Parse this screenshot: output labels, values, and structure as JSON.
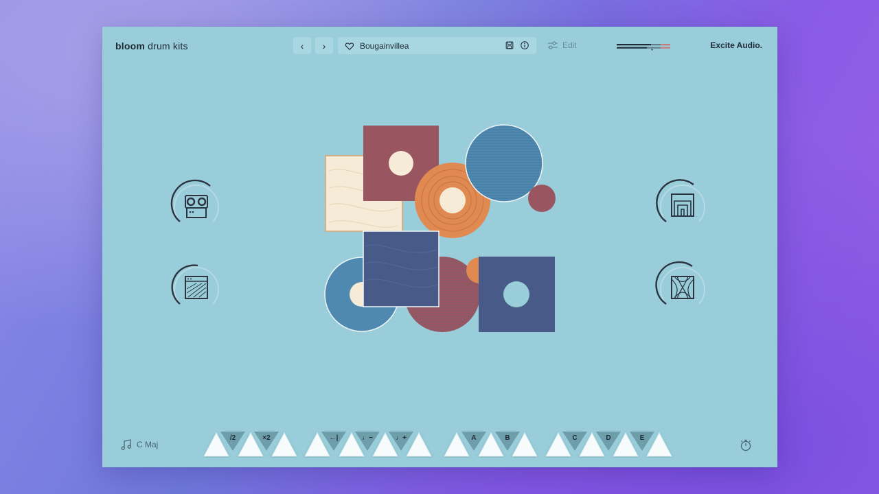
{
  "header": {
    "title_bold": "bloom",
    "title_light": "drum kits",
    "prev_label": "‹",
    "next_label": "›",
    "preset_name": "Bougainvillea",
    "edit_label": "Edit",
    "brand": "Excite Audio."
  },
  "icons": {
    "favorite": "heart-icon",
    "save": "save-icon",
    "info": "info-icon",
    "edit": "sliders-icon",
    "key": "music-note-icon",
    "timer": "stopwatch-icon"
  },
  "knobs": {
    "left_top": "tape-icon",
    "left_bottom": "amp-icon",
    "right_top": "room-icon",
    "right_bottom": "distortion-icon"
  },
  "footer": {
    "key_label": "C Maj",
    "pattern_buttons": [
      "/2",
      "×2",
      "←|",
      "♩−",
      "♩+",
      "A",
      "B",
      "C",
      "D",
      "E"
    ]
  },
  "colors": {
    "background": "#99cdd9",
    "maroon": "#9a5660",
    "orange": "#e08a52",
    "blue": "#4f88b0",
    "navy": "#485a88",
    "cream": "#f6ebd6",
    "text": "#1f2a36"
  }
}
